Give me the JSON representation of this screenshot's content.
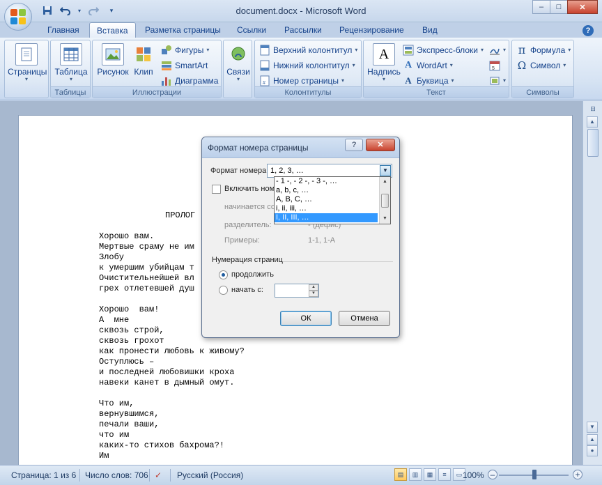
{
  "window": {
    "title": "document.docx - Microsoft Word",
    "minimize": "–",
    "maximize": "□",
    "close": "✕"
  },
  "qat": {
    "save_icon": "save-icon",
    "undo_icon": "undo-icon",
    "redo_icon": "redo-icon",
    "customize_icon": "customize-icon"
  },
  "tabs": [
    {
      "label": "Главная",
      "active": false
    },
    {
      "label": "Вставка",
      "active": true
    },
    {
      "label": "Разметка страницы",
      "active": false
    },
    {
      "label": "Ссылки",
      "active": false
    },
    {
      "label": "Рассылки",
      "active": false
    },
    {
      "label": "Рецензирование",
      "active": false
    },
    {
      "label": "Вид",
      "active": false
    }
  ],
  "ribbon": {
    "pages": {
      "button": "Страницы",
      "group": ""
    },
    "tables": {
      "button": "Таблица",
      "group": "Таблицы"
    },
    "illustrations": {
      "group": "Иллюстрации",
      "picture": "Рисунок",
      "clip": "Клип",
      "shapes": "Фигуры",
      "smartart": "SmartArt",
      "chart": "Диаграмма"
    },
    "links": {
      "button": "Связи",
      "group": ""
    },
    "headers": {
      "group": "Колонтитулы",
      "header": "Верхний колонтитул",
      "footer": "Нижний колонтитул",
      "page_number": "Номер страницы"
    },
    "text": {
      "group": "Текст",
      "textbox": "Надпись",
      "quickparts": "Экспресс-блоки",
      "wordart": "WordArt",
      "dropcap": "Буквица"
    },
    "symbols": {
      "group": "Символы",
      "equation": "Формула",
      "symbol": "Символ"
    }
  },
  "document": {
    "heading": "ПРОЛОГ",
    "lines": [
      "Хорошо вам.",
      "Мертвые сраму не им",
      "Злобу",
      "к умершим убийцам т",
      "Очистительнейшей вл",
      "грех отлетевшей душ",
      "",
      "Хорошо  вам!",
      "А  мне",
      "сквозь строй,",
      "сквозь грохот",
      "как пронести любовь к живому?",
      "Оступлюсь –",
      "и последней любовишки кроха",
      "навеки канет в дымный омут.",
      "",
      "Что им,",
      "вернувшимся,",
      "печали ваши,",
      "что им",
      "каких-то стихов бахрома?!",
      "Им"
    ]
  },
  "dialog": {
    "title": "Формат номера страницы",
    "help": "?",
    "close": "✕",
    "format_label": "Формат номера:",
    "format_value": "1, 2, 3, …",
    "dropdown_options": [
      "- 1 -, - 2 -, - 3 -, …",
      "a, b, c, …",
      "A, B, C, …",
      "i, ii, iii, …",
      "I, II, III, …"
    ],
    "selected_option_index": 4,
    "include_chapter": "Включить номе",
    "starts_with": "начинается со",
    "separator_label": "разделитель:",
    "separator_value": "-    (дефис)",
    "examples_label": "Примеры:",
    "examples_value": "1-1, 1-A",
    "numbering_group": "Нумерация страниц",
    "continue_label": "продолжить",
    "start_at_label": "начать с:",
    "start_at_value": "",
    "ok": "ОК",
    "cancel": "Отмена"
  },
  "statusbar": {
    "page": "Страница: 1 из 6",
    "words": "Число слов: 706",
    "language": "Русский (Россия)",
    "zoom": "100%",
    "zoom_minus": "–",
    "zoom_plus": "+"
  }
}
